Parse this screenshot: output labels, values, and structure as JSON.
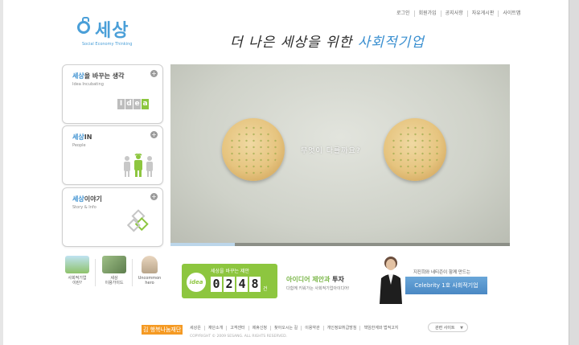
{
  "header": {
    "top_links": [
      "로그인",
      "회원가입",
      "공지사항",
      "자유게시판",
      "사이트맵"
    ],
    "logo_text": "세상",
    "logo_subtitle": "Social Economy Thinking",
    "slogan_prefix": "더 나은 세상을 위한 ",
    "slogan_accent": "사회적기업"
  },
  "sidebar": {
    "boxes": [
      {
        "title_blue": "세상",
        "title_rest": "을 바꾸는 생각",
        "subtitle": "Idea Incubating",
        "image_letters": [
          "I",
          "d",
          "e",
          "a"
        ]
      },
      {
        "title_blue": "세상",
        "title_rest": "IN",
        "subtitle": "People"
      },
      {
        "title_blue": "세상",
        "title_rest": "이야기",
        "subtitle": "Story & Info"
      }
    ],
    "plus_symbol": "+"
  },
  "video": {
    "caption": "무엇이 다를까요?",
    "progress": 0.19
  },
  "quick_links": [
    {
      "label": "사회적기업\n이란?",
      "color": "#8ec26a"
    },
    {
      "label": "세상\n이용가이드",
      "color": "#6f8f5f"
    },
    {
      "label": "Uncommon\nhero",
      "color": "#c9b9a0"
    }
  ],
  "counter": {
    "top_label": "세상을 바꾸는 제안",
    "badge": "idea",
    "digits": [
      "0",
      "2",
      "4",
      "8"
    ],
    "unit": "건"
  },
  "info": {
    "title_green": "아이디어 제안과 ",
    "title_dark": "투자",
    "subtitle": "다함께 키워가는 사회적기업아이디어!"
  },
  "celebrity": {
    "intro": "지진희와 네티즌이 함께 만드는",
    "banner": "Celebrity 1호 사회적기업"
  },
  "footer": {
    "logo": "김 행복나눔재단",
    "links": [
      "세상은",
      "재단소개",
      "고객센터",
      "제휴신청",
      "찾아오시는 길",
      "이용약관",
      "개인정보취급방침",
      "책임한계와 법적고지"
    ],
    "copyright": "COPYRIGHT © 2009 SESANG. ALL RIGHTS RESERVED.",
    "select_label": "관련 사이트",
    "select_chevron": "▼"
  },
  "colors": {
    "brand_blue": "#4a9fd8",
    "accent_green": "#8dc63f",
    "footer_orange": "#f59a23"
  }
}
